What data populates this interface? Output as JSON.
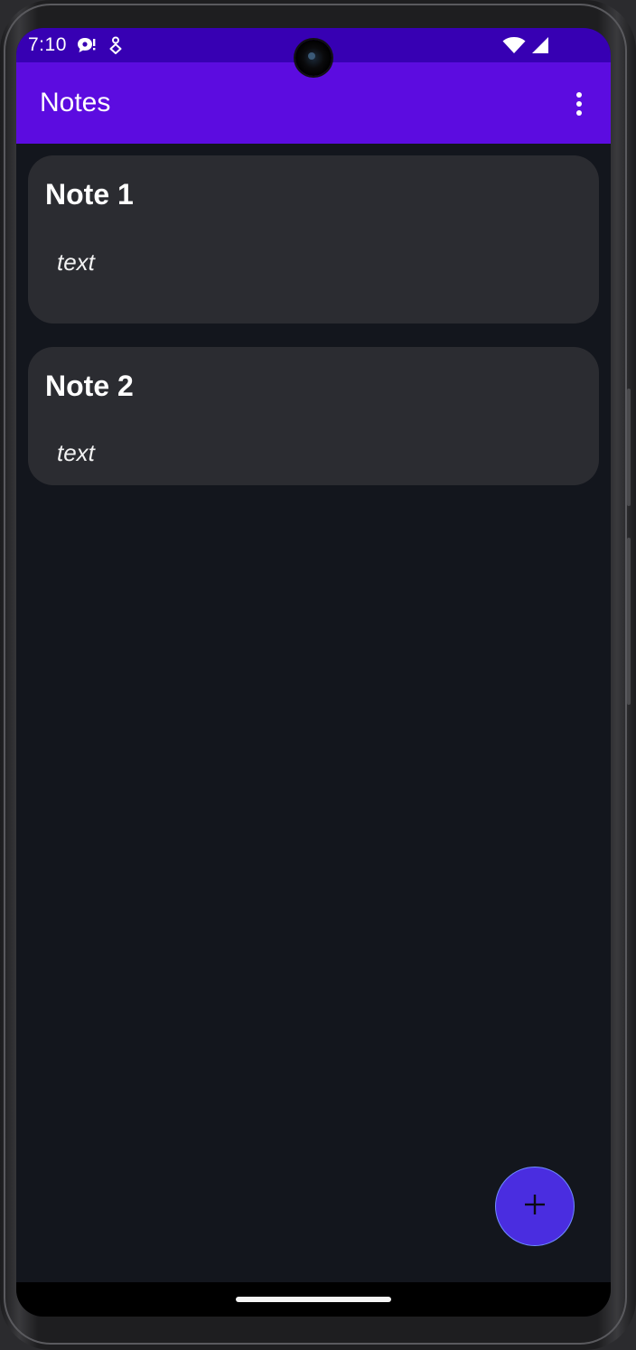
{
  "status_bar": {
    "time": "7:10",
    "left_icons": [
      "chat-notification-icon",
      "location-person-icon"
    ],
    "right_icons": [
      "wifi-icon",
      "cellular-signal-icon"
    ],
    "background_color": "#3700b3"
  },
  "app_bar": {
    "title": "Notes",
    "background_color": "#5c0ce0",
    "menu_icon": "overflow-menu-icon"
  },
  "notes": [
    {
      "title": "Note 1",
      "text": "text"
    },
    {
      "title": "Note 2",
      "text": "text"
    }
  ],
  "fab": {
    "icon": "plus-icon",
    "background_color": "#4a2de0"
  },
  "colors": {
    "screen_background": "#13161d",
    "card_background": "#2b2c31"
  }
}
